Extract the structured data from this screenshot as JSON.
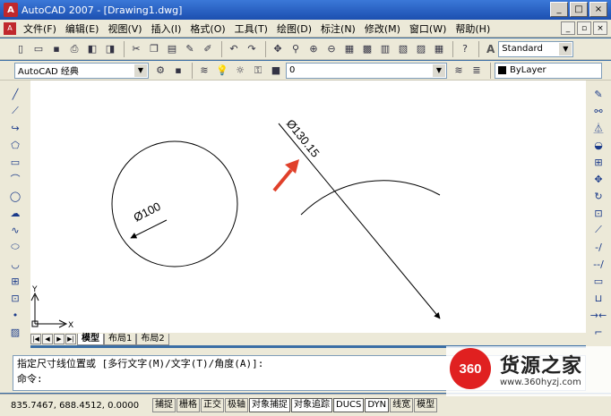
{
  "window": {
    "title": "AutoCAD 2007 - [Drawing1.dwg]",
    "app_icon_text": "A"
  },
  "window_buttons": [
    "_",
    "□",
    "×"
  ],
  "menu": {
    "items": [
      "文件(F)",
      "编辑(E)",
      "视图(V)",
      "插入(I)",
      "格式(O)",
      "工具(T)",
      "绘图(D)",
      "标注(N)",
      "修改(M)",
      "窗口(W)",
      "帮助(H)"
    ],
    "mdi_buttons": [
      "_",
      "▫",
      "×"
    ]
  },
  "toolbar_top": {
    "style_combo": "Standard"
  },
  "toolbar_second": {
    "workspace_combo": "AutoCAD 经典",
    "layer_combo": "0",
    "color_combo": "ByLayer"
  },
  "drawing": {
    "circle_dim_text": "Ø100",
    "arc_dim_text": "Ø130.15",
    "ucs_x": "X",
    "ucs_y": "Y",
    "accent_color": "#e0402a"
  },
  "tabs": [
    "模型",
    "布局1",
    "布局2"
  ],
  "command": {
    "line1": "指定尺寸线位置或 [多行文字(M)/文字(T)/角度(A)]:",
    "line2": "命令:"
  },
  "status": {
    "coords": "835.7467, 688.4512, 0.0000",
    "buttons": [
      "捕捉",
      "栅格",
      "正交",
      "极轴",
      "对象捕捉",
      "对象追踪",
      "DUCS",
      "DYN",
      "线宽",
      "模型"
    ]
  },
  "watermark": {
    "logo": "360",
    "name": "货源之家",
    "url": "www.360hyzj.com"
  }
}
